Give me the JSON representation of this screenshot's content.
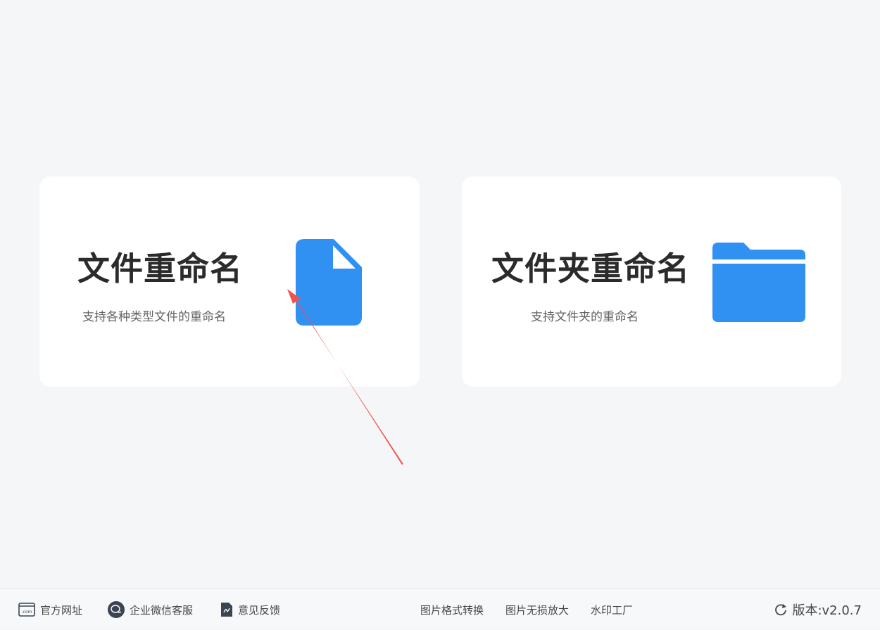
{
  "cards": [
    {
      "title": "文件重命名",
      "description": "支持各种类型文件的重命名",
      "icon": "file-icon"
    },
    {
      "title": "文件夹重命名",
      "description": "支持文件夹的重命名",
      "icon": "folder-icon"
    }
  ],
  "footer": {
    "website_label": "官方网址",
    "website_icon": "website-com-icon",
    "wechat_label": "企业微信客服",
    "wechat_icon": "wechat-chat-icon",
    "feedback_label": "意见反馈",
    "feedback_icon": "feedback-document-icon",
    "convert_label": "图片格式转换",
    "enlarge_label": "图片无损放大",
    "watermark_label": "水印工厂",
    "version_label": "版本:v2.0.7",
    "version_icon": "refresh-icon"
  },
  "colors": {
    "accent": "#3191f2",
    "annotation_arrow": "#ef5350",
    "background": "#f5f6f8",
    "card": "#ffffff"
  }
}
